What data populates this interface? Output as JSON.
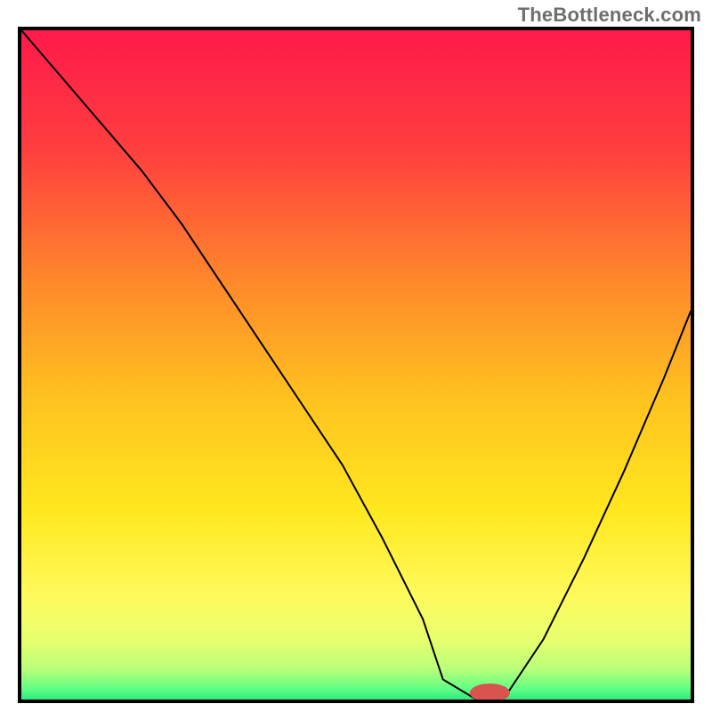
{
  "watermark": "TheBottleneck.com",
  "chart_data": {
    "type": "line",
    "title": "",
    "xlabel": "",
    "ylabel": "",
    "xlim": [
      0,
      100
    ],
    "ylim": [
      0,
      100
    ],
    "grid": false,
    "legend": false,
    "annotations": [],
    "background_gradient": {
      "stops": [
        {
          "pos": 0.0,
          "color": "#ff1a4b"
        },
        {
          "pos": 0.18,
          "color": "#ff3f3f"
        },
        {
          "pos": 0.38,
          "color": "#ff8a2a"
        },
        {
          "pos": 0.55,
          "color": "#ffc21f"
        },
        {
          "pos": 0.72,
          "color": "#ffe81f"
        },
        {
          "pos": 0.84,
          "color": "#fff95a"
        },
        {
          "pos": 0.91,
          "color": "#e9ff6e"
        },
        {
          "pos": 0.955,
          "color": "#b8ff7a"
        },
        {
          "pos": 0.985,
          "color": "#5dff86"
        },
        {
          "pos": 1.0,
          "color": "#31e87e"
        }
      ]
    },
    "series": [
      {
        "name": "bottleneck-curve",
        "color": "#000000",
        "x": [
          0,
          6,
          12,
          18,
          24,
          30,
          36,
          42,
          48,
          54,
          60,
          63,
          68,
          72,
          78,
          84,
          90,
          96,
          100
        ],
        "y": [
          100,
          93,
          86,
          79,
          71,
          62,
          53,
          44,
          35,
          24,
          12,
          3,
          0,
          0,
          9,
          21,
          34,
          48,
          58
        ]
      }
    ],
    "marker": {
      "name": "optimum-marker",
      "color": "#d9534f",
      "x": 70,
      "y": 1,
      "rx": 3,
      "ry": 1.4
    }
  }
}
